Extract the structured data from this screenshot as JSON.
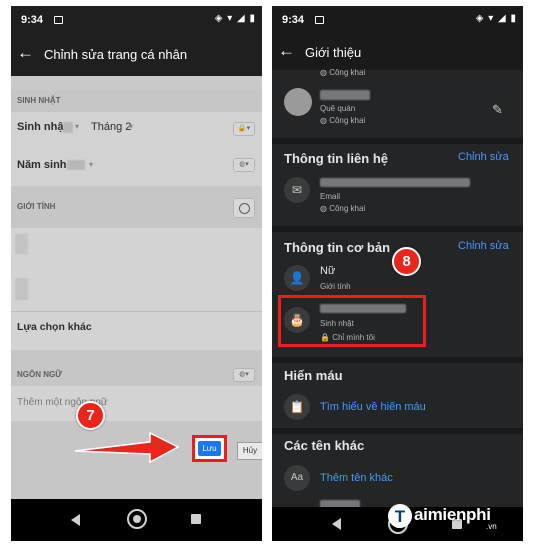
{
  "status": {
    "time_left": "9:34",
    "time_right": "9:34"
  },
  "left": {
    "title": "Chỉnh sửa trang cá nhân",
    "birthday_section": "SINH NHẬT",
    "birthday_label": "Sinh nhật",
    "birthday_month": "Tháng 2",
    "birth_year_label": "Năm sinh",
    "gender_section": "GIỚI TÍNH",
    "more_options": "Lựa chọn khác",
    "language_section": "NGÔN NGỮ",
    "language_placeholder": "Thêm một ngôn ngữ",
    "save_label": "Lưu",
    "cancel_label": "Hủy",
    "step_badge": "7"
  },
  "right": {
    "title": "Giới thiệu",
    "top_privacy": "Công khai",
    "hometown_label": "Quê quán",
    "hometown_privacy": "Công khai",
    "contact_heading": "Thông tin liên hệ",
    "contact_edit": "Chỉnh sửa",
    "email_label": "Email",
    "email_privacy": "Công khai",
    "basic_heading": "Thông tin cơ bản",
    "basic_edit": "Chỉnh sửa",
    "gender_value": "Nữ",
    "gender_label": "Giới tính",
    "birthday_label": "Sinh nhật",
    "birthday_privacy": "Chỉ mình tôi",
    "blood_heading": "Hiến máu",
    "blood_link": "Tìm hiểu về hiến máu",
    "other_names_heading": "Các tên khác",
    "add_other_name": "Thêm tên khác",
    "step_badge": "8"
  },
  "watermark": {
    "brand": "aimienphi",
    "initial": "T",
    "tld": ".vn"
  },
  "colors": {
    "accent": "#1877f2",
    "highlight": "#ee1c1c",
    "link": "#4599ff"
  },
  "icons": [
    "back-arrow-icon",
    "lock-icon",
    "globe-icon",
    "mail-icon",
    "person-icon",
    "cake-icon",
    "clipboard-icon",
    "text-icon",
    "pencil-icon"
  ]
}
